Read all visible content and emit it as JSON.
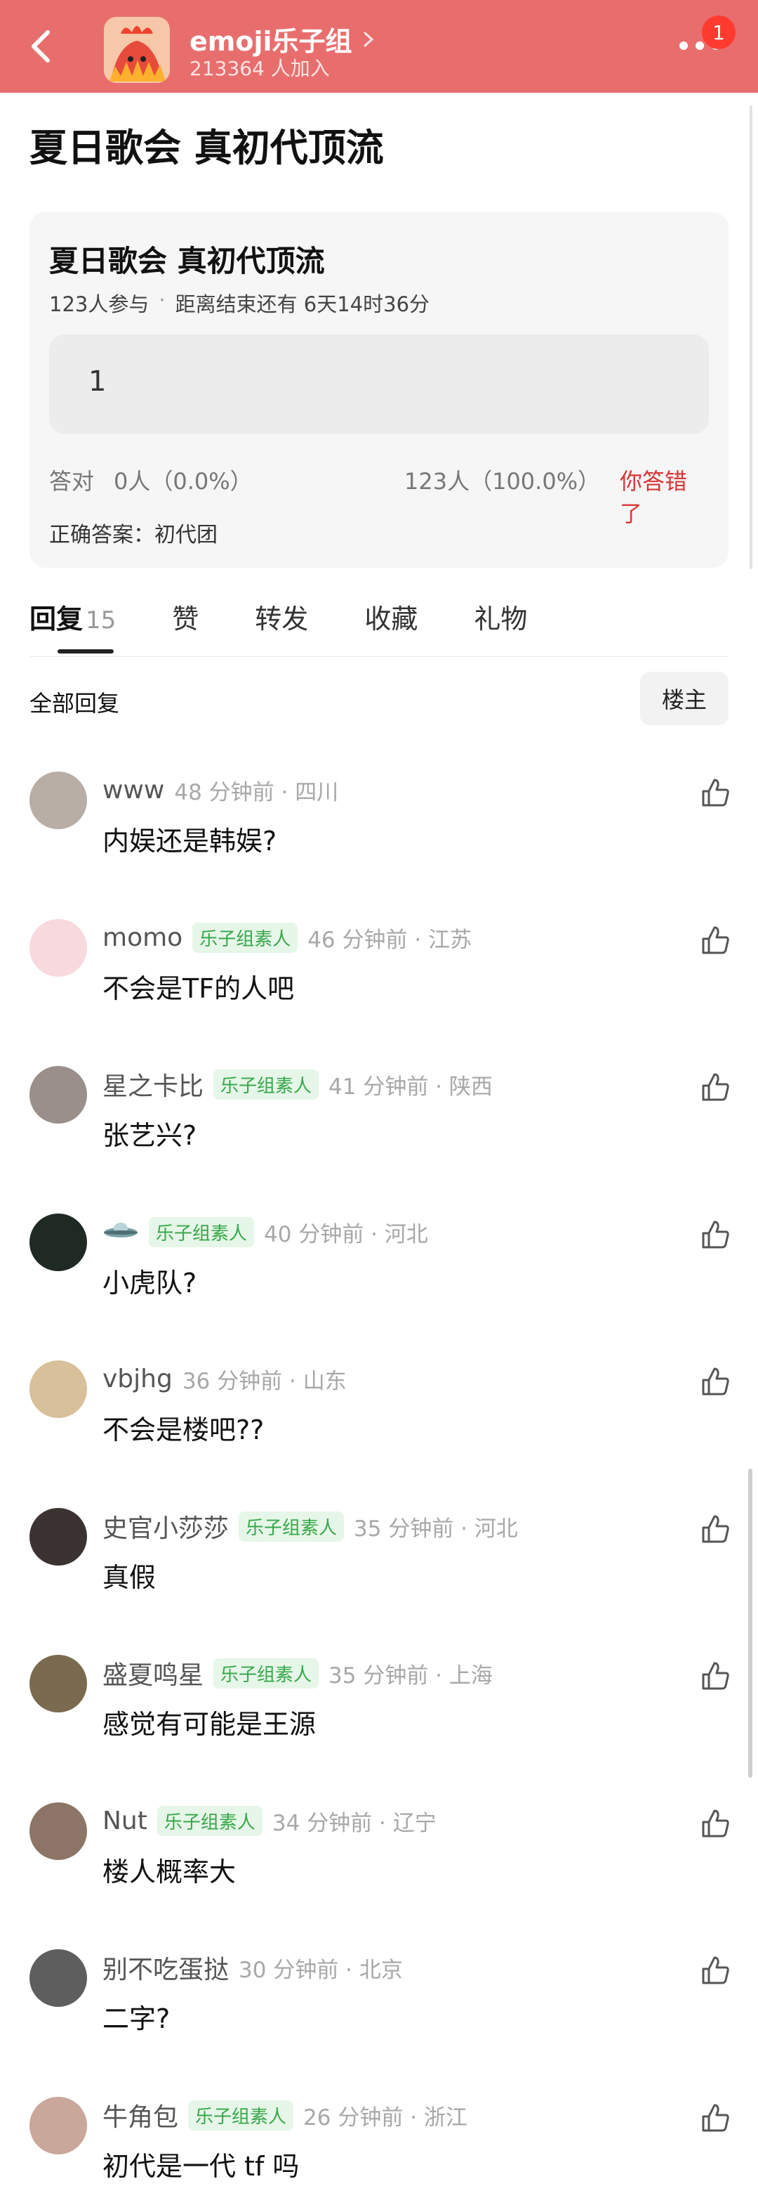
{
  "header": {
    "group_name": "emoji乐子组",
    "member_count": "213364 人加入",
    "notification_count": "1",
    "colors": {
      "bar": "#e86e6e",
      "badge": "#ff3b30"
    }
  },
  "post": {
    "title": "夏日歌会 真初代顶流"
  },
  "quiz": {
    "title": "夏日歌会 真初代顶流",
    "participants": "123人参与",
    "separator": "·",
    "deadline": "距离结束还有 6天14时36分",
    "option_text": "1",
    "correct_label": "答对",
    "correct_value": "0人（0.0%）",
    "wrong_value": "123人（100.0%）",
    "wrong_label": "你答错了",
    "answer": "正确答案：初代团"
  },
  "tabs": [
    {
      "label": "回复",
      "count": "15"
    },
    {
      "label": "赞"
    },
    {
      "label": "转发"
    },
    {
      "label": "收藏"
    },
    {
      "label": "礼物"
    }
  ],
  "replies_header": {
    "title": "全部回复",
    "owner_filter": "楼主"
  },
  "comments": [
    {
      "name": "www",
      "badge": "",
      "time": "48 分钟前 · 四川",
      "text": "内娱还是韩娱?",
      "avatar_color": "#b9aea6"
    },
    {
      "name": "momo",
      "badge": "乐子组素人",
      "time": "46 分钟前 · 江苏",
      "text": "不会是TF的人吧",
      "avatar_color": "#f7d9de"
    },
    {
      "name": "星之卡比",
      "badge": "乐子组素人",
      "time": "41 分钟前 · 陕西",
      "text": "张艺兴?",
      "avatar_color": "#9a8f8a"
    },
    {
      "name": "",
      "badge": "乐子组素人",
      "time": "40 分钟前 · 河北",
      "text": "小虎队?",
      "avatar_color": "#1f2a24",
      "name_icon": "ufo-icon"
    },
    {
      "name": "vbjhg",
      "badge": "",
      "time": "36 分钟前 · 山东",
      "text": "不会是楼吧??",
      "avatar_color": "#d7c09a"
    },
    {
      "name": "史官小莎莎",
      "badge": "乐子组素人",
      "time": "35 分钟前 · 河北",
      "text": "真假",
      "avatar_color": "#3b3332"
    },
    {
      "name": "盛夏鸣星",
      "badge": "乐子组素人",
      "time": "35 分钟前 · 上海",
      "text": "感觉有可能是王源",
      "avatar_color": "#7a6a4f"
    },
    {
      "name": "Nut",
      "badge": "乐子组素人",
      "time": "34 分钟前 · 辽宁",
      "text": "楼人概率大",
      "avatar_color": "#8c7566"
    },
    {
      "name": "别不吃蛋挞",
      "badge": "",
      "time": "30 分钟前 · 北京",
      "text": "二字?",
      "avatar_color": "#5e5e5e"
    },
    {
      "name": "牛角包",
      "badge": "乐子组素人",
      "time": "26 分钟前 · 浙江",
      "text": "初代是一代 tf 吗",
      "avatar_color": "#c9a79a"
    }
  ]
}
